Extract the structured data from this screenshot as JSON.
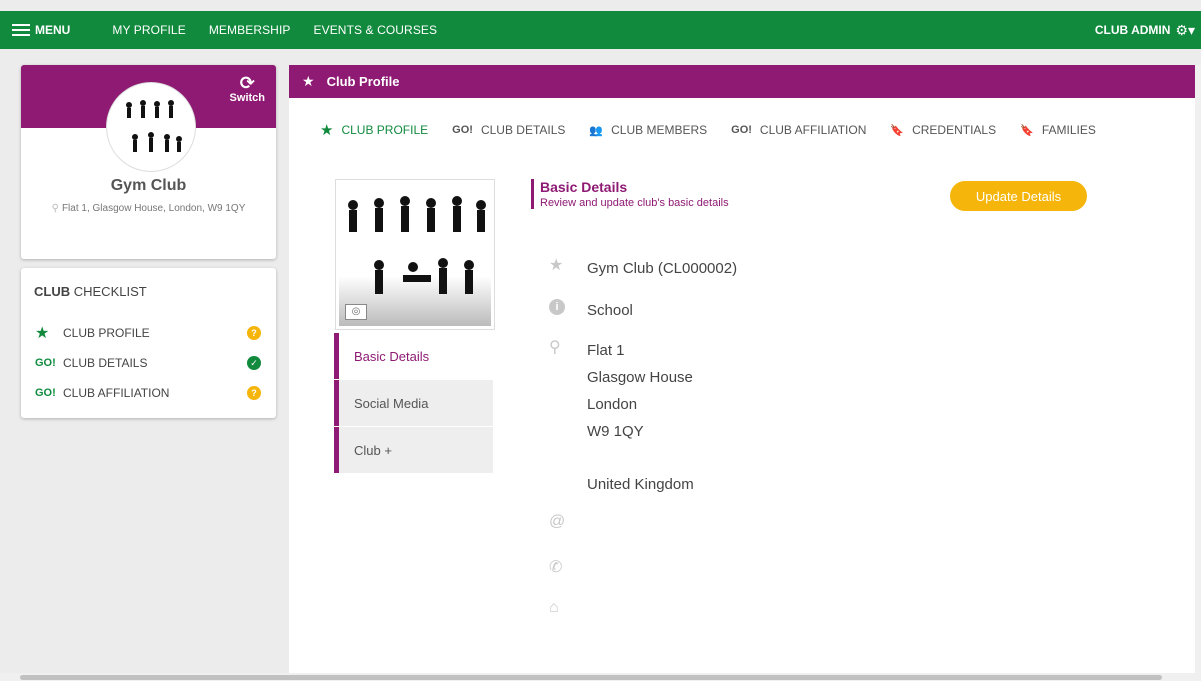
{
  "topbar": {
    "menu_label": "MENU",
    "nav": [
      "MY PROFILE",
      "MEMBERSHIP",
      "EVENTS & COURSES"
    ],
    "admin_label": "CLUB ADMIN"
  },
  "profile": {
    "switch_label": "Switch",
    "club_name": "Gym Club",
    "address": "Flat 1, Glasgow House, London, W9 1QY"
  },
  "checklist": {
    "title_bold": "CLUB",
    "title_rest": "CHECKLIST",
    "items": [
      {
        "icon": "★",
        "label": "CLUB PROFILE",
        "status": "?"
      },
      {
        "icon": "GO!",
        "label": "CLUB DETAILS",
        "status": "✓"
      },
      {
        "icon": "GO!",
        "label": "CLUB AFFILIATION",
        "status": "?"
      }
    ]
  },
  "main": {
    "header_title": "Club Profile",
    "tabs": [
      {
        "icon": "★",
        "label": "CLUB PROFILE"
      },
      {
        "icon": "GO!",
        "label": "CLUB DETAILS"
      },
      {
        "icon": "👥",
        "label": "CLUB MEMBERS"
      },
      {
        "icon": "GO!",
        "label": "CLUB AFFILIATION"
      },
      {
        "icon": "🔖",
        "label": "CREDENTIALS"
      },
      {
        "icon": "🔖",
        "label": "FAMILIES"
      }
    ],
    "side_tabs": [
      "Basic Details",
      "Social Media",
      "Club +"
    ],
    "section_title": "Basic Details",
    "section_subtitle": "Review and update club's basic details",
    "update_button": "Update Details",
    "details": {
      "name_id": "Gym Club (CL000002)",
      "type": "School",
      "address_lines": [
        "Flat 1",
        "Glasgow House",
        "London",
        "W9 1QY",
        "",
        "United Kingdom"
      ]
    }
  }
}
